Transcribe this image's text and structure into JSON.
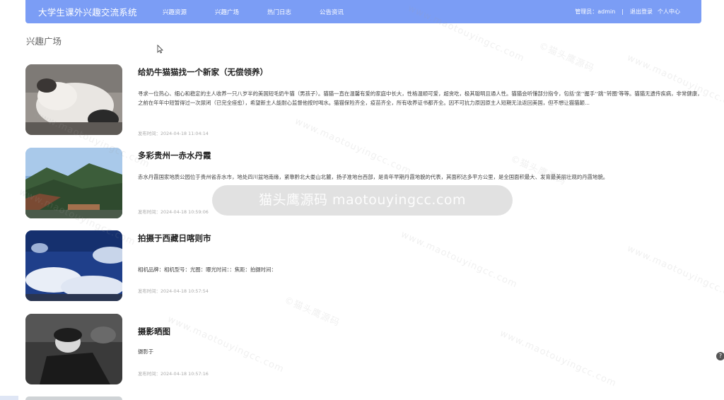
{
  "header": {
    "brand": "大学生课外兴趣交流系统",
    "nav": [
      "兴趣资源",
      "兴趣广场",
      "热门日志",
      "公告资讯"
    ],
    "user_label": "管理员：admin",
    "separator": "|",
    "logout": "退出登录",
    "profile": "个人中心"
  },
  "section_title": "兴趣广场",
  "posts": [
    {
      "title": "给奶牛猫猫找一个新家（无偿领养）",
      "body": "寻求一位热心、细心和稳定的主人收养一只八岁半的美国短毛奶牛猫（男孩子）。猫猫一直在温馨有爱的家庭中长大，性格温顺可爱，超贪吃，极其聪明且通人性。猫猫会听懂部分指令，包括‘坐’‘握手’‘跳’‘转圈’等等。猫猫无遗传疾病，非常健康，之前在年年中短暂得过一次尿闭（已完全痊愈），希望新主人能耐心监督他按时喝水。猫猫保险齐全，疫苗齐全，所有收养证书都齐全。因不可抗力原因原主人短期无法返回美国，但不想让猫猫颠...",
      "time": "发布时间：2024-04-18 11:04:14",
      "image": "cat-photo"
    },
    {
      "title": "多彩贵州一赤水丹霞",
      "body": "赤水丹霞国家地质公园位于贵州省赤水市，地处四川盆地南缘，紧靠黔北大娄山北麓，扬子准地台西部，是青年早期丹霞地貌的代表，其面积达多平方公里，是全国面积最大、发育最美丽壮观的丹霞地貌。",
      "time": "发布时间：2024-04-18 10:59:06",
      "image": "mountain-landscape-photo"
    },
    {
      "title": "拍摄于西藏日喀则市",
      "body": "相机品牌：相机型号：光圈：曝光时间：：焦距：拍摄时间：",
      "time": "发布时间：2024-04-18 10:57:54",
      "image": "sky-clouds-photo"
    },
    {
      "title": "摄影晒图",
      "body": "摄影于",
      "time": "发布时间：2024-04-18 10:57:16",
      "image": "portrait-photo"
    }
  ],
  "watermark": {
    "banner": "猫头鹰源码 maotouyingcc.com",
    "site": "www.maotouyingcc.com",
    "mark": "©猫头鹰源码"
  },
  "help_icon": "?"
}
